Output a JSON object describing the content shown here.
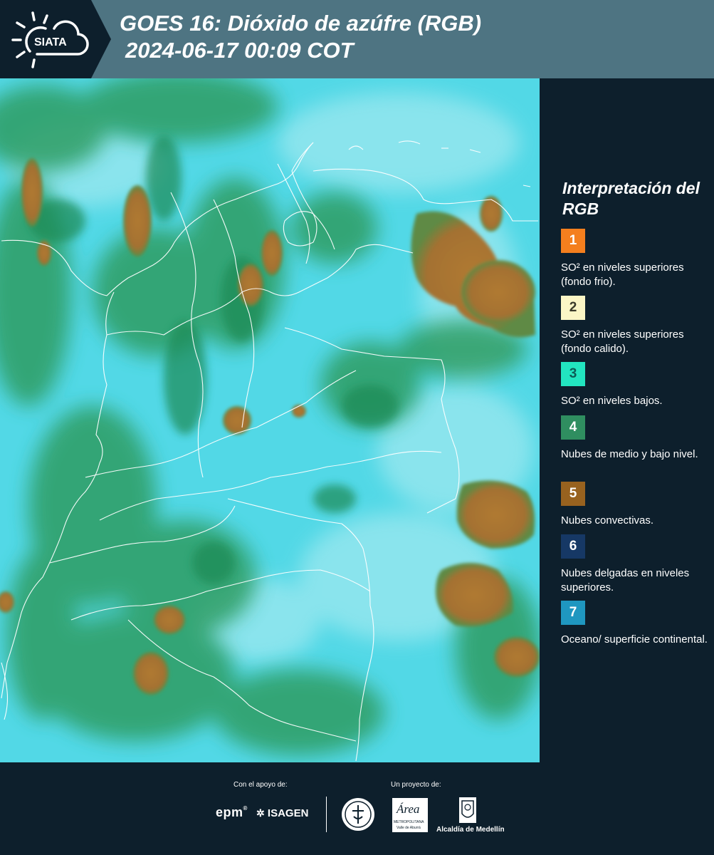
{
  "header": {
    "logo_text": "SIATA",
    "title_line1": "GOES 16: Dióxido de azúfre (RGB)",
    "title_line2": "2024-06-17 00:09 COT"
  },
  "legend": {
    "title": "Interpretación del RGB",
    "items": [
      {
        "number": "1",
        "text": "SO² en niveles superiores (fondo frio).",
        "color": "#f47f1e",
        "number_color": "#ffffff"
      },
      {
        "number": "2",
        "text": "SO² en niveles superiores (fondo calido).",
        "color": "#fbf6c6",
        "number_color": "#3a3a2a"
      },
      {
        "number": "3",
        "text": "SO² en niveles bajos.",
        "color": "#22e5c0",
        "number_color": "#0d5a55"
      },
      {
        "number": "4",
        "text": "Nubes de medio y bajo nivel.",
        "color": "#2f8e60",
        "number_color": "#ffffff"
      },
      {
        "number": "5",
        "text": "Nubes convectivas.",
        "color": "#98621f",
        "number_color": "#ffffff"
      },
      {
        "number": "6",
        "text": "Nubes delgadas en niveles superiores.",
        "color": "#163865",
        "number_color": "#ffffff"
      },
      {
        "number": "7",
        "text": "Oceano/ superficie continental.",
        "color": "#1f97c0",
        "number_color": "#ffffff"
      }
    ]
  },
  "footer": {
    "support_label": "Con el apoyo de:",
    "project_label": "Un proyecto de:",
    "epm_text": "epm",
    "isagen_text": "ISAGEN",
    "area_text": "Área",
    "area_sub1": "METROPOLITANA",
    "area_sub2": "Valle de Aburrá",
    "alcaldia_text": "Alcaldía de Medellín"
  },
  "colors": {
    "background": "#0d1f2c",
    "header_band": "#4e7482",
    "map_base": "#4fd6e4",
    "map_green": "#3aa86a",
    "convective": "#a9762e"
  }
}
